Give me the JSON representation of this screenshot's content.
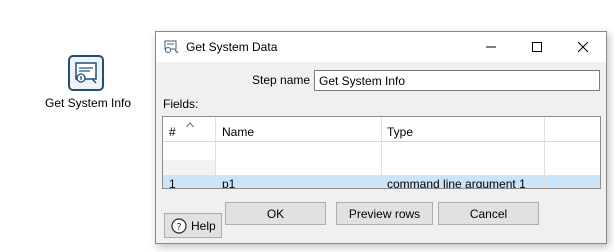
{
  "canvas": {
    "step_label": "Get System Info",
    "step_icon": "system-info-step-icon"
  },
  "dialog": {
    "title": "Get System Data",
    "title_icon": "system-data-icon",
    "controls": {
      "minimize": "minimize-icon",
      "maximize": "maximize-icon",
      "close": "close-icon"
    },
    "step_name_label": "Step name",
    "step_name_value": "Get System Info",
    "fields_label": "Fields:",
    "table": {
      "columns": [
        "#",
        "Name",
        "Type"
      ],
      "rows": [
        {
          "num": "1",
          "name": "p1",
          "type": "command line argument 1"
        }
      ]
    },
    "buttons": {
      "ok": "OK",
      "preview": "Preview rows",
      "cancel": "Cancel",
      "help": "Help"
    },
    "colors": {
      "selected_row": "#cce4f7",
      "button_face": "#e1e1e1",
      "dialog_bg": "#f0f0f0"
    }
  }
}
